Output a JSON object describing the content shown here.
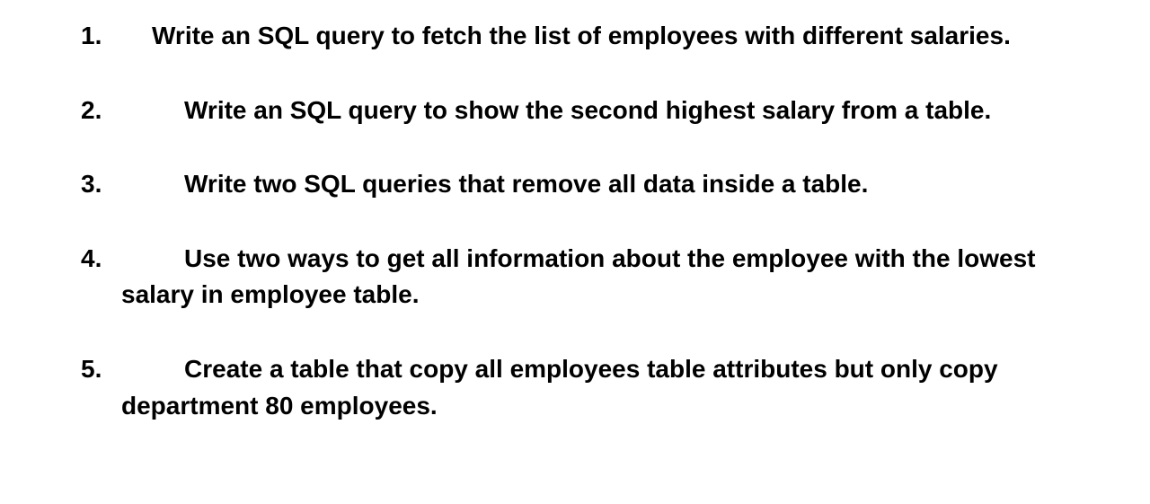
{
  "questions": [
    {
      "number": "1.",
      "text": "Write an SQL query to fetch the list of employees with different salaries.",
      "indent": "indent-1"
    },
    {
      "number": "2.",
      "text": "Write an SQL query to show the second highest salary from a table.",
      "indent": "indent-2"
    },
    {
      "number": "3.",
      "text": "Write two SQL queries that remove all data inside a table.",
      "indent": "indent-2"
    },
    {
      "number": "4.",
      "text": "Use two ways to get all information about the employee with the lowest salary in employee table.",
      "indent": "indent-2"
    },
    {
      "number": "5.",
      "text": "Create a table that copy all employees table attributes but only copy department 80 employees.",
      "indent": "indent-2"
    }
  ]
}
